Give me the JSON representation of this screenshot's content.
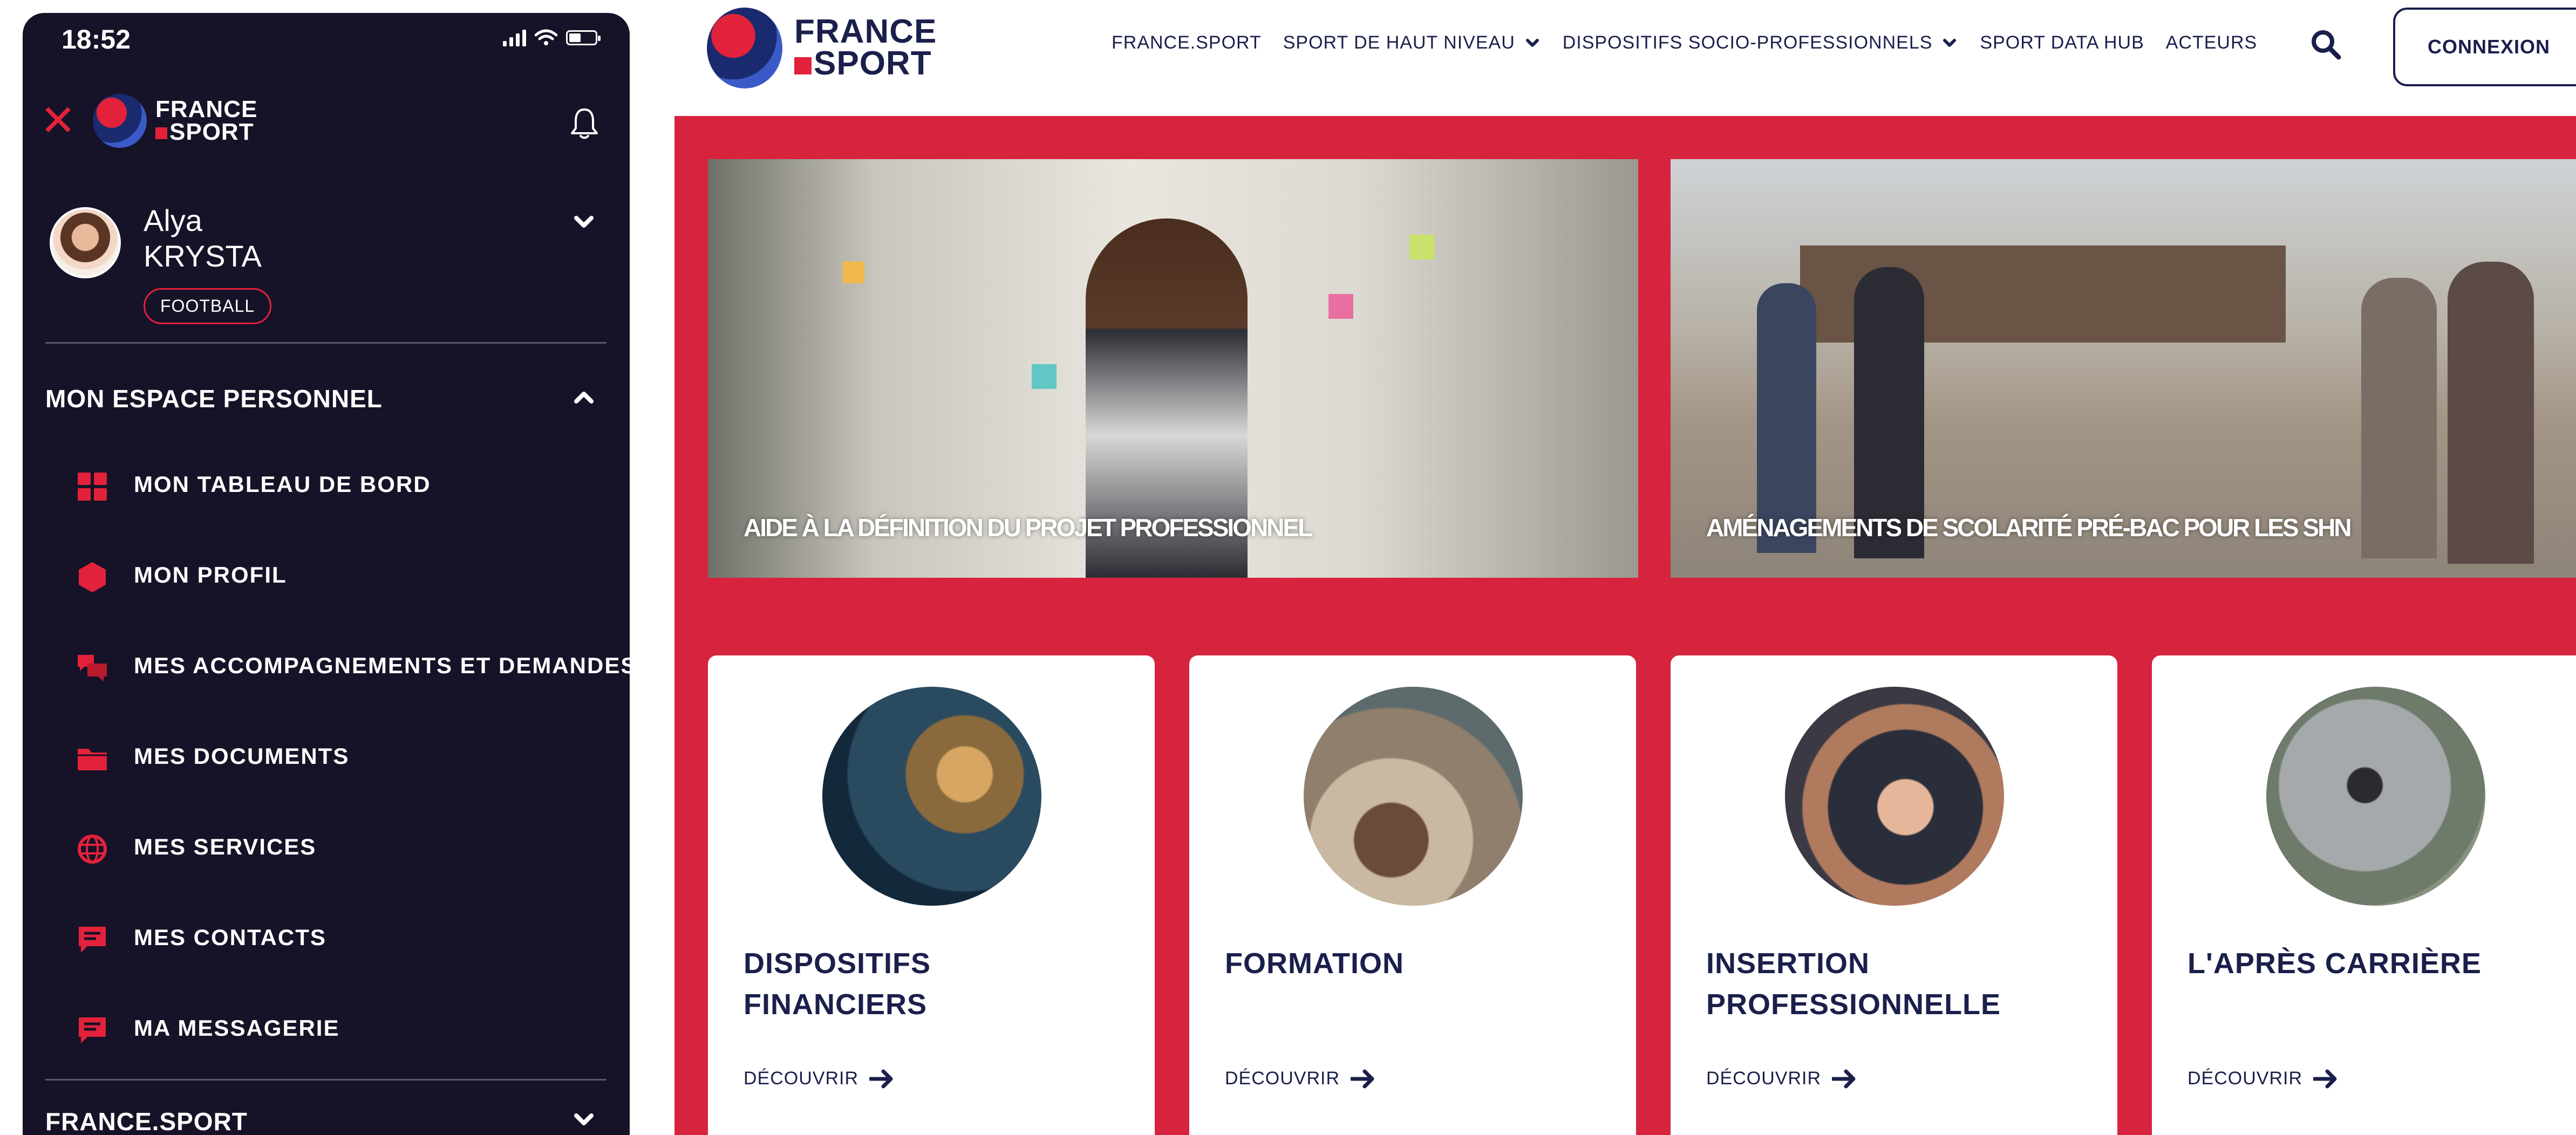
{
  "phone": {
    "status": {
      "time": "18:52"
    },
    "brand": {
      "line1": "FRANCE",
      "line2": "SPORT"
    },
    "profile": {
      "first_name": "Alya",
      "last_name": "KRYSTA",
      "sport": "FOOTBALL"
    },
    "sections": [
      {
        "title": "MON ESPACE PERSONNEL",
        "expanded": true
      },
      {
        "title": "FRANCE.SPORT",
        "expanded": false
      }
    ],
    "menu": [
      {
        "label": "MON TABLEAU DE BORD",
        "icon": "dashboard-grid-icon"
      },
      {
        "label": "MON PROFIL",
        "icon": "hexagon-profile-icon"
      },
      {
        "label": "MES ACCOMPAGNEMENTS ET DEMANDES",
        "icon": "chat-bubbles-icon"
      },
      {
        "label": "MES DOCUMENTS",
        "icon": "folder-icon"
      },
      {
        "label": "MES SERVICES",
        "icon": "globe-icon"
      },
      {
        "label": "MES CONTACTS",
        "icon": "message-icon"
      },
      {
        "label": "MA MESSAGERIE",
        "icon": "message-icon"
      }
    ]
  },
  "site": {
    "brand": {
      "line1": "FRANCE",
      "line2": "SPORT"
    },
    "nav": [
      {
        "label": "FRANCE.SPORT",
        "dropdown": false
      },
      {
        "label": "SPORT DE HAUT NIVEAU",
        "dropdown": true
      },
      {
        "label": "DISPOSITIFS SOCIO-PROFESSIONNELS",
        "dropdown": true
      },
      {
        "label": "SPORT DATA HUB",
        "dropdown": false
      },
      {
        "label": "ACTEURS",
        "dropdown": false
      }
    ],
    "login_label": "CONNEXION",
    "heroes": [
      {
        "caption": "AIDE À LA DÉFINITION DU PROJET PROFESSIONNEL"
      },
      {
        "caption": "AMÉNAGEMENTS DE SCOLARITÉ PRÉ-BAC POUR LES SHN"
      }
    ],
    "cards": [
      {
        "title": "DISPOSITIFS FINANCIERS",
        "link": "DÉCOUVRIR"
      },
      {
        "title": "FORMATION",
        "link": "DÉCOUVRIR"
      },
      {
        "title": "INSERTION PROFESSIONNELLE",
        "link": "DÉCOUVRIR"
      },
      {
        "title": "L'APRÈS CARRIÈRE",
        "link": "DÉCOUVRIR"
      }
    ]
  },
  "colors": {
    "brand_red": "#d6243f",
    "accent_red": "#e2223a",
    "navy": "#1a1f4b",
    "phone_bg": "#161227"
  }
}
